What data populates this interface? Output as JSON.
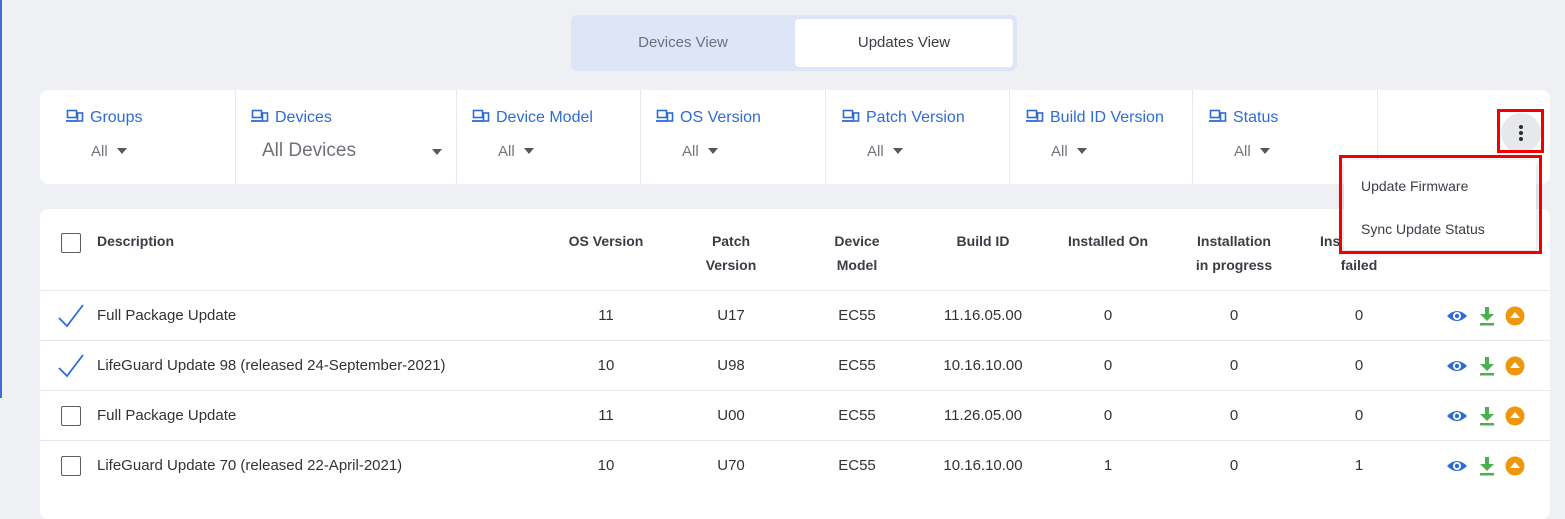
{
  "view_toggle": {
    "devices_label": "Devices View",
    "updates_label": "Updates View",
    "active": "Updates View"
  },
  "filters": [
    {
      "label": "Groups",
      "value": "All"
    },
    {
      "label": "Devices",
      "value": "All Devices"
    },
    {
      "label": "Device Model",
      "value": "All"
    },
    {
      "label": "OS Version",
      "value": "All"
    },
    {
      "label": "Patch Version",
      "value": "All"
    },
    {
      "label": "Build ID Version",
      "value": "All"
    },
    {
      "label": "Status",
      "value": "All"
    }
  ],
  "menu": {
    "items": [
      "Update Firmware",
      "Sync Update Status"
    ]
  },
  "table": {
    "headers": {
      "description": "Description",
      "os_version": "OS Version",
      "patch_version_1": "Patch",
      "patch_version_2": "Version",
      "device_model_1": "Device",
      "device_model_2": "Model",
      "build_id": "Build ID",
      "installed_on": "Installed On",
      "in_progress_1": "Installation",
      "in_progress_2": "in progress",
      "failed_1": "Ins",
      "failed_2": "failed"
    },
    "rows": [
      {
        "checked": true,
        "description": "Full Package Update",
        "os": "11",
        "patch": "U17",
        "model": "EC55",
        "build": "11.16.05.00",
        "installed": "0",
        "progress": "0",
        "failed": "0"
      },
      {
        "checked": true,
        "description": "LifeGuard Update 98 (released 24-September-2021)",
        "os": "10",
        "patch": "U98",
        "model": "EC55",
        "build": "10.16.10.00",
        "installed": "0",
        "progress": "0",
        "failed": "0"
      },
      {
        "checked": false,
        "description": "Full Package Update",
        "os": "11",
        "patch": "U00",
        "model": "EC55",
        "build": "11.26.05.00",
        "installed": "0",
        "progress": "0",
        "failed": "0"
      },
      {
        "checked": false,
        "description": "LifeGuard Update 70 (released 22-April-2021)",
        "os": "10",
        "patch": "U70",
        "model": "EC55",
        "build": "10.16.10.00",
        "installed": "1",
        "progress": "0",
        "failed": "1"
      }
    ]
  },
  "colors": {
    "accent": "#2e6bd6",
    "highlight": "#f00000",
    "download": "#4caf50",
    "upload": "#f0960a"
  },
  "icons": [
    "device-group-icon",
    "more-vert-icon",
    "eye-icon",
    "download-icon",
    "upload-icon",
    "check-icon"
  ]
}
